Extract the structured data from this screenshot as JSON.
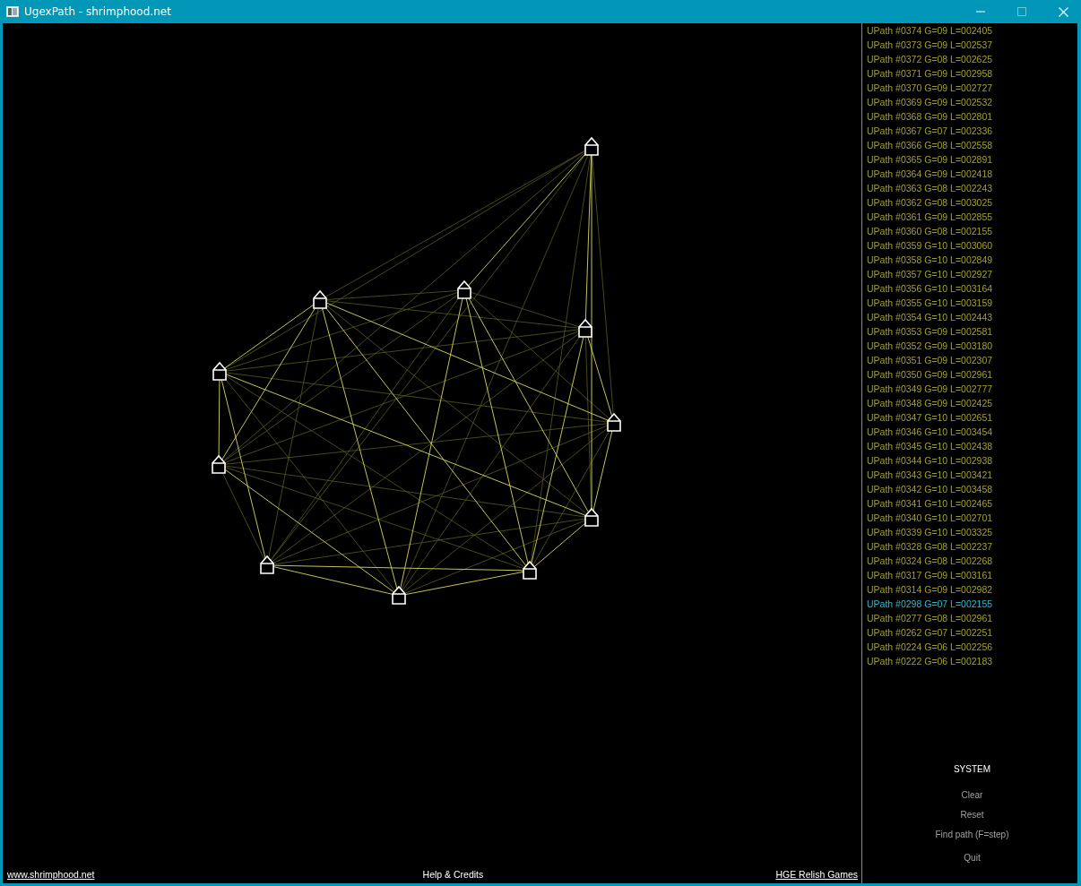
{
  "window": {
    "title": "UgexPath - shrimphood.net"
  },
  "paths": [
    {
      "label": "UPath #0374 G=09 L=002405",
      "selected": false
    },
    {
      "label": "UPath #0373 G=09 L=002537",
      "selected": false
    },
    {
      "label": "UPath #0372 G=08 L=002625",
      "selected": false
    },
    {
      "label": "UPath #0371 G=09 L=002958",
      "selected": false
    },
    {
      "label": "UPath #0370 G=09 L=002727",
      "selected": false
    },
    {
      "label": "UPath #0369 G=09 L=002532",
      "selected": false
    },
    {
      "label": "UPath #0368 G=09 L=002801",
      "selected": false
    },
    {
      "label": "UPath #0367 G=07 L=002336",
      "selected": false
    },
    {
      "label": "UPath #0366 G=08 L=002558",
      "selected": false
    },
    {
      "label": "UPath #0365 G=09 L=002891",
      "selected": false
    },
    {
      "label": "UPath #0364 G=09 L=002418",
      "selected": false
    },
    {
      "label": "UPath #0363 G=08 L=002243",
      "selected": false
    },
    {
      "label": "UPath #0362 G=08 L=003025",
      "selected": false
    },
    {
      "label": "UPath #0361 G=09 L=002855",
      "selected": false
    },
    {
      "label": "UPath #0360 G=08 L=002155",
      "selected": false
    },
    {
      "label": "UPath #0359 G=10 L=003060",
      "selected": false
    },
    {
      "label": "UPath #0358 G=10 L=002849",
      "selected": false
    },
    {
      "label": "UPath #0357 G=10 L=002927",
      "selected": false
    },
    {
      "label": "UPath #0356 G=10 L=003164",
      "selected": false
    },
    {
      "label": "UPath #0355 G=10 L=003159",
      "selected": false
    },
    {
      "label": "UPath #0354 G=10 L=002443",
      "selected": false
    },
    {
      "label": "UPath #0353 G=09 L=002581",
      "selected": false
    },
    {
      "label": "UPath #0352 G=09 L=003180",
      "selected": false
    },
    {
      "label": "UPath #0351 G=09 L=002307",
      "selected": false
    },
    {
      "label": "UPath #0350 G=09 L=002961",
      "selected": false
    },
    {
      "label": "UPath #0349 G=09 L=002777",
      "selected": false
    },
    {
      "label": "UPath #0348 G=09 L=002425",
      "selected": false
    },
    {
      "label": "UPath #0347 G=10 L=002651",
      "selected": false
    },
    {
      "label": "UPath #0346 G=10 L=003454",
      "selected": false
    },
    {
      "label": "UPath #0345 G=10 L=002438",
      "selected": false
    },
    {
      "label": "UPath #0344 G=10 L=002938",
      "selected": false
    },
    {
      "label": "UPath #0343 G=10 L=003421",
      "selected": false
    },
    {
      "label": "UPath #0342 G=10 L=003458",
      "selected": false
    },
    {
      "label": "UPath #0341 G=10 L=002465",
      "selected": false
    },
    {
      "label": "UPath #0340 G=10 L=002701",
      "selected": false
    },
    {
      "label": "UPath #0339 G=10 L=003325",
      "selected": false
    },
    {
      "label": "UPath #0328 G=08 L=002237",
      "selected": false
    },
    {
      "label": "UPath #0324 G=08 L=002268",
      "selected": false
    },
    {
      "label": "UPath #0317 G=09 L=003161",
      "selected": false
    },
    {
      "label": "UPath #0314 G=09 L=002982",
      "selected": false
    },
    {
      "label": "UPath #0298 G=07 L=002155",
      "selected": true
    },
    {
      "label": "UPath #0277 G=08 L=002961",
      "selected": false
    },
    {
      "label": "UPath #0262 G=07 L=002251",
      "selected": false
    },
    {
      "label": "UPath #0224 G=06 L=002256",
      "selected": false
    },
    {
      "label": "UPath #0222 G=06 L=002183",
      "selected": false
    }
  ],
  "system_menu": {
    "title": "SYSTEM",
    "items": [
      "Clear",
      "Reset",
      "Find path (F=step)",
      "Quit"
    ]
  },
  "footer": {
    "left_link": "www.shrimphood.net",
    "center": "Help & Credits",
    "right_link": "HGE Relish Games"
  }
}
